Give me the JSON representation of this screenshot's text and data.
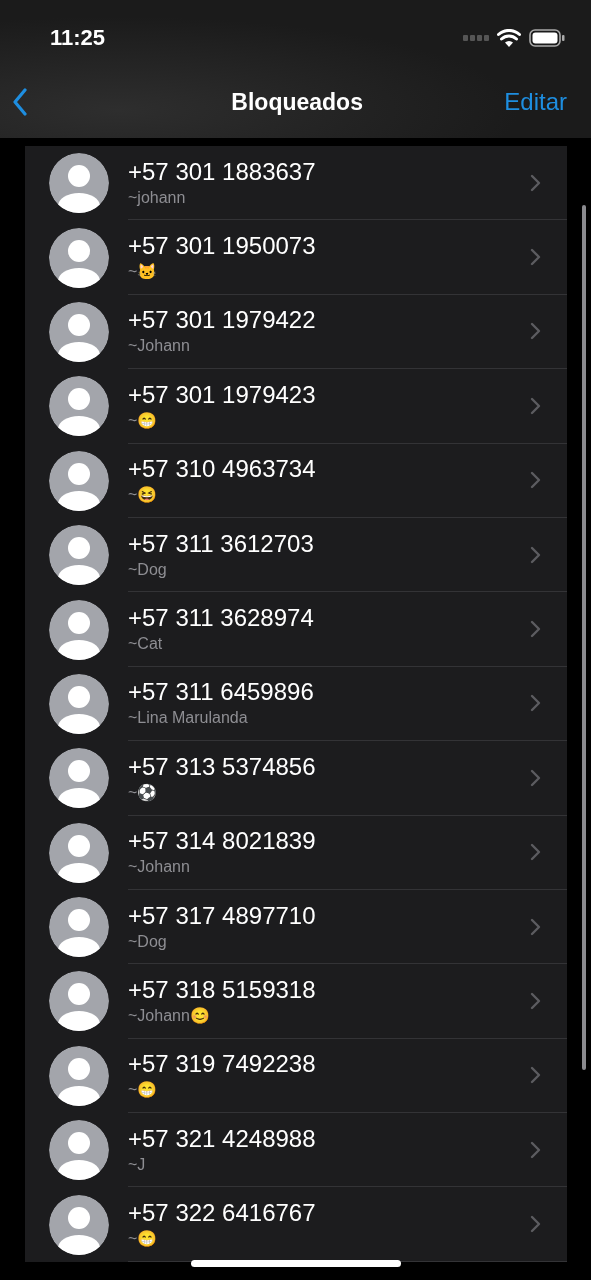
{
  "status_bar": {
    "time": "11:25"
  },
  "nav": {
    "title": "Bloqueados",
    "action": "Editar"
  },
  "contacts": [
    {
      "phone": "+57 301 1883637",
      "name": "~johann"
    },
    {
      "phone": "+57 301 1950073",
      "name": "~🐱"
    },
    {
      "phone": "+57 301 1979422",
      "name": "~Johann"
    },
    {
      "phone": "+57 301 1979423",
      "name": "~😁"
    },
    {
      "phone": "+57 310 4963734",
      "name": "~😆"
    },
    {
      "phone": "+57 311 3612703",
      "name": "~Dog"
    },
    {
      "phone": "+57 311 3628974",
      "name": "~Cat"
    },
    {
      "phone": "+57 311 6459896",
      "name": "~Lina Marulanda"
    },
    {
      "phone": "+57 313 5374856",
      "name": "~⚽"
    },
    {
      "phone": "+57 314 8021839",
      "name": "~Johann"
    },
    {
      "phone": "+57 317 4897710",
      "name": "~Dog"
    },
    {
      "phone": "+57 318 5159318",
      "name": "~Johann😊"
    },
    {
      "phone": "+57 319 7492238",
      "name": "~😁"
    },
    {
      "phone": "+57 321 4248988",
      "name": "~J"
    },
    {
      "phone": "+57 322 6416767",
      "name": "~😁"
    }
  ]
}
